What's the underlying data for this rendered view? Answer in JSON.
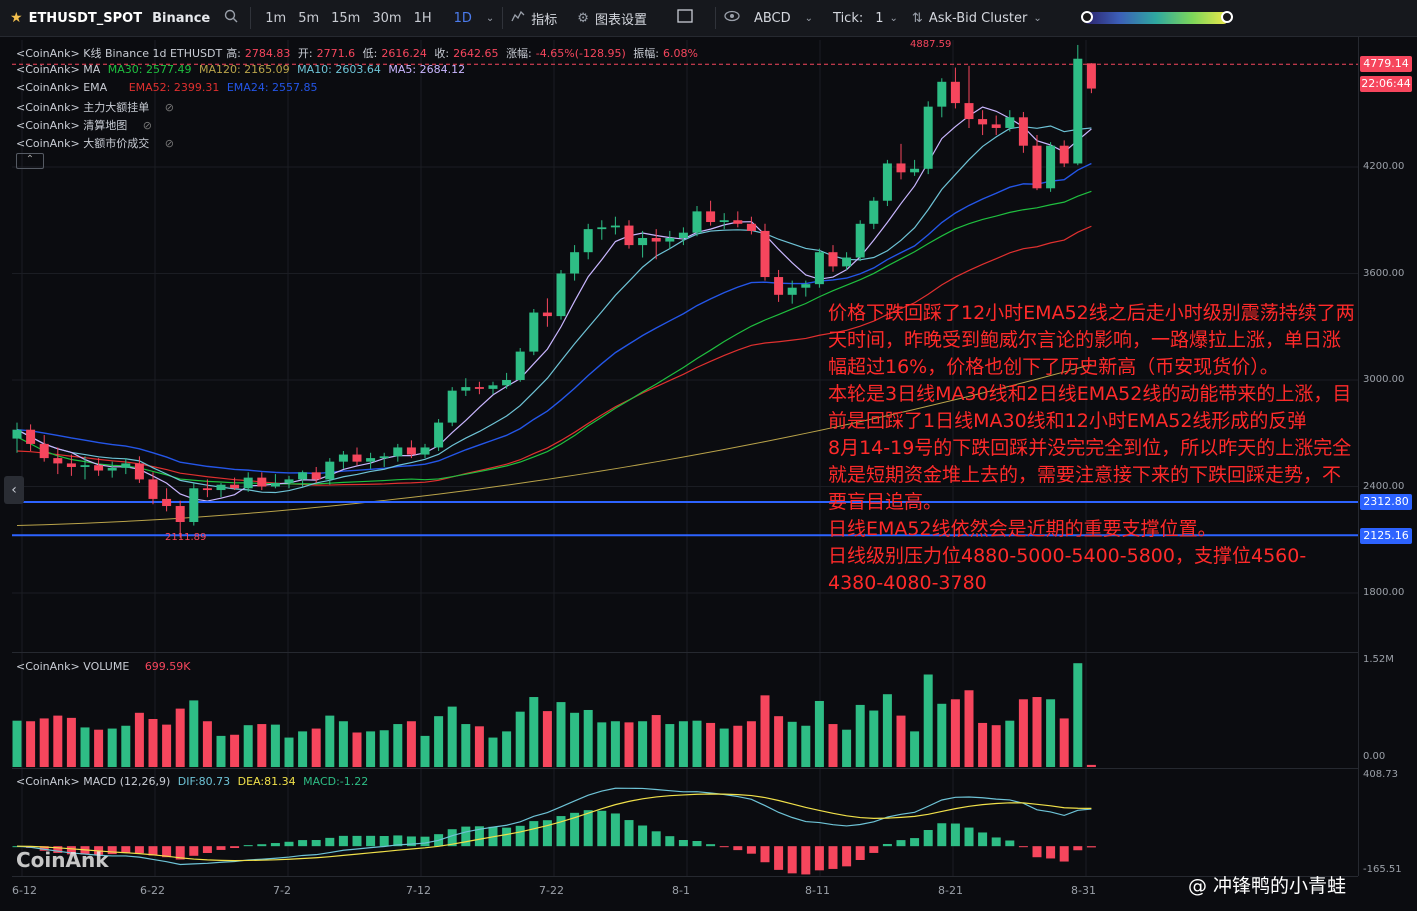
{
  "toolbar": {
    "symbol": "ETHUSDT_SPOT",
    "exchange": "Binance",
    "timeframes": [
      "1m",
      "5m",
      "15m",
      "30m",
      "1H",
      "1D"
    ],
    "active_timeframe": "1D",
    "indicators_label": "指标",
    "chart_settings_label": "图表设置",
    "abcd_label": "ABCD",
    "tick_label": "Tick:",
    "tick_value": "1",
    "ask_bid_label": "Ask-Bid Cluster"
  },
  "legends": {
    "kline": {
      "prefix": "<CoinAnk> K线  Binance 1d ETHUSDT",
      "high_label": "高:",
      "high": "2784.83",
      "open_label": "开:",
      "open": "2771.6",
      "low_label": "低:",
      "low": "2616.24",
      "close_label": "收:",
      "close": "2642.65",
      "change_label": "涨幅:",
      "change": "-4.65%(-128.95)",
      "amp_label": "振幅:",
      "amp": "6.08%"
    },
    "ma": {
      "prefix": "<CoinAnk> MA",
      "ma30": "MA30: 2577.49",
      "ma120": "MA120: 2165.09",
      "ma10": "MA10: 2603.64",
      "ma5": "MA5: 2684.12"
    },
    "ema": {
      "prefix": "<CoinAnk> EMA",
      "ema52": "EMA52: 2399.31",
      "ema24": "EMA24: 2557.85"
    },
    "big_orders": "<CoinAnk> 主力大额挂单",
    "liq_map": "<CoinAnk> 清算地图",
    "big_trades": "<CoinAnk> 大额市价成交",
    "volume": {
      "prefix": "<CoinAnk> VOLUME",
      "value": "699.59K"
    },
    "macd": {
      "prefix": "<CoinAnk> MACD (12,26,9)",
      "dif": "DIF:80.73",
      "dea": "DEA:81.34",
      "macd": "MACD:-1.22"
    }
  },
  "price_axis": {
    "ticks": [
      "4200.00",
      "3600.00",
      "3000.00",
      "2400.00",
      "1800.00"
    ],
    "current_price": "4779.14",
    "countdown": "22:06:44",
    "line1": "2312.80",
    "line2": "2125.16",
    "high_marker": "4887.59",
    "low_marker": "2111.89"
  },
  "volume_axis": {
    "top": "1.52M",
    "bottom": "0.00"
  },
  "macd_axis": {
    "top": "408.73",
    "bottom": "-165.51"
  },
  "time_axis": [
    "6-12",
    "6-22",
    "7-2",
    "7-12",
    "7-22",
    "8-1",
    "8-11",
    "8-21",
    "8-31"
  ],
  "annotation": "价格下跌回踩了12小时EMA52线之后走小时级别震荡持续了两天时间，昨晚受到鲍威尔言论的影响，一路爆拉上涨，单日涨幅超过16%，价格也创下了历史新高（币安现货价）。\n本轮是3日线MA30线和2日线EMA52线的动能带来的上涨，目前是回踩了1日线MA30线和12小时EMA52线形成的反弹\n8月14-19号的下跌回踩并没完完全到位，所以昨天的上涨完全就是短期资金堆上去的，需要注意接下来的下跌回踩走势，不要盲目追高。\n日线EMA52线依然会是近期的重要支撑位置。\n日线级别压力位4880-5000-5400-5800，支撑位4560-4380-4080-3780",
  "watermark": "CoinAnk",
  "credit": "@ 冲锋鸭的小青蛙",
  "colors": {
    "up": "#2ebd85",
    "down": "#f6465d",
    "ma5": "#c9b6ff",
    "ma10": "#6ec3d6",
    "ma30": "#1fbf3f",
    "ma120": "#b9a34a",
    "ema24": "#2456e8",
    "ema52": "#e0302f",
    "hline": "#2d63ff"
  },
  "chart_data": {
    "type": "candlestick",
    "x_start_label": "6-12",
    "candles": [
      [
        2670,
        2760,
        2590,
        2720
      ],
      [
        2720,
        2750,
        2600,
        2640
      ],
      [
        2640,
        2690,
        2540,
        2560
      ],
      [
        2560,
        2620,
        2470,
        2530
      ],
      [
        2530,
        2580,
        2460,
        2510
      ],
      [
        2510,
        2570,
        2440,
        2520
      ],
      [
        2520,
        2560,
        2460,
        2490
      ],
      [
        2490,
        2540,
        2450,
        2505
      ],
      [
        2505,
        2560,
        2470,
        2530
      ],
      [
        2530,
        2570,
        2420,
        2440
      ],
      [
        2440,
        2480,
        2300,
        2330
      ],
      [
        2330,
        2390,
        2260,
        2290
      ],
      [
        2290,
        2320,
        2111.89,
        2200
      ],
      [
        2200,
        2420,
        2180,
        2390
      ],
      [
        2390,
        2440,
        2340,
        2380
      ],
      [
        2380,
        2420,
        2340,
        2410
      ],
      [
        2410,
        2450,
        2380,
        2390
      ],
      [
        2390,
        2480,
        2370,
        2450
      ],
      [
        2450,
        2480,
        2380,
        2400
      ],
      [
        2400,
        2470,
        2390,
        2420
      ],
      [
        2420,
        2460,
        2390,
        2440
      ],
      [
        2440,
        2490,
        2400,
        2480
      ],
      [
        2480,
        2510,
        2420,
        2440
      ],
      [
        2440,
        2560,
        2410,
        2540
      ],
      [
        2540,
        2600,
        2500,
        2580
      ],
      [
        2580,
        2620,
        2520,
        2540
      ],
      [
        2540,
        2590,
        2500,
        2560
      ],
      [
        2560,
        2590,
        2510,
        2570
      ],
      [
        2570,
        2640,
        2540,
        2620
      ],
      [
        2620,
        2660,
        2560,
        2580
      ],
      [
        2580,
        2640,
        2560,
        2620
      ],
      [
        2620,
        2780,
        2600,
        2760
      ],
      [
        2760,
        2960,
        2740,
        2940
      ],
      [
        2940,
        3010,
        2910,
        2960
      ],
      [
        2960,
        2990,
        2920,
        2950
      ],
      [
        2950,
        2990,
        2920,
        2970
      ],
      [
        2970,
        3040,
        2950,
        3000
      ],
      [
        3000,
        3180,
        2990,
        3160
      ],
      [
        3160,
        3400,
        3140,
        3380
      ],
      [
        3380,
        3460,
        3300,
        3360
      ],
      [
        3360,
        3620,
        3340,
        3600
      ],
      [
        3600,
        3760,
        3560,
        3720
      ],
      [
        3720,
        3880,
        3680,
        3850
      ],
      [
        3850,
        3900,
        3790,
        3860
      ],
      [
        3860,
        3920,
        3820,
        3870
      ],
      [
        3870,
        3900,
        3740,
        3760
      ],
      [
        3760,
        3840,
        3690,
        3800
      ],
      [
        3800,
        3850,
        3680,
        3780
      ],
      [
        3780,
        3840,
        3740,
        3800
      ],
      [
        3800,
        3860,
        3760,
        3830
      ],
      [
        3830,
        3980,
        3810,
        3950
      ],
      [
        3950,
        4010,
        3870,
        3890
      ],
      [
        3890,
        3940,
        3850,
        3900
      ],
      [
        3900,
        3950,
        3860,
        3880
      ],
      [
        3880,
        3920,
        3820,
        3840
      ],
      [
        3840,
        3880,
        3560,
        3580
      ],
      [
        3580,
        3620,
        3440,
        3480
      ],
      [
        3480,
        3560,
        3430,
        3520
      ],
      [
        3520,
        3560,
        3470,
        3540
      ],
      [
        3540,
        3740,
        3520,
        3720
      ],
      [
        3720,
        3760,
        3610,
        3640
      ],
      [
        3640,
        3720,
        3620,
        3690
      ],
      [
        3690,
        3900,
        3670,
        3880
      ],
      [
        3880,
        4030,
        3850,
        4010
      ],
      [
        4010,
        4240,
        3980,
        4220
      ],
      [
        4220,
        4330,
        4130,
        4170
      ],
      [
        4170,
        4240,
        4150,
        4190
      ],
      [
        4190,
        4570,
        4160,
        4540
      ],
      [
        4540,
        4700,
        4480,
        4680
      ],
      [
        4680,
        4760,
        4530,
        4560
      ],
      [
        4560,
        4770,
        4420,
        4470
      ],
      [
        4470,
        4520,
        4380,
        4440
      ],
      [
        4440,
        4490,
        4380,
        4420
      ],
      [
        4420,
        4520,
        4400,
        4480
      ],
      [
        4480,
        4510,
        4280,
        4320
      ],
      [
        4320,
        4380,
        4070,
        4080
      ],
      [
        4080,
        4340,
        4060,
        4320
      ],
      [
        4320,
        4350,
        4200,
        4220
      ],
      [
        4220,
        4887.59,
        4210,
        4810
      ],
      [
        4784,
        4785,
        4616,
        4642
      ]
    ],
    "volume_ylim": [
      0,
      1520000
    ],
    "macd_ylim": [
      -165.51,
      408.73
    ],
    "ylim": [
      1600,
      4950
    ]
  }
}
